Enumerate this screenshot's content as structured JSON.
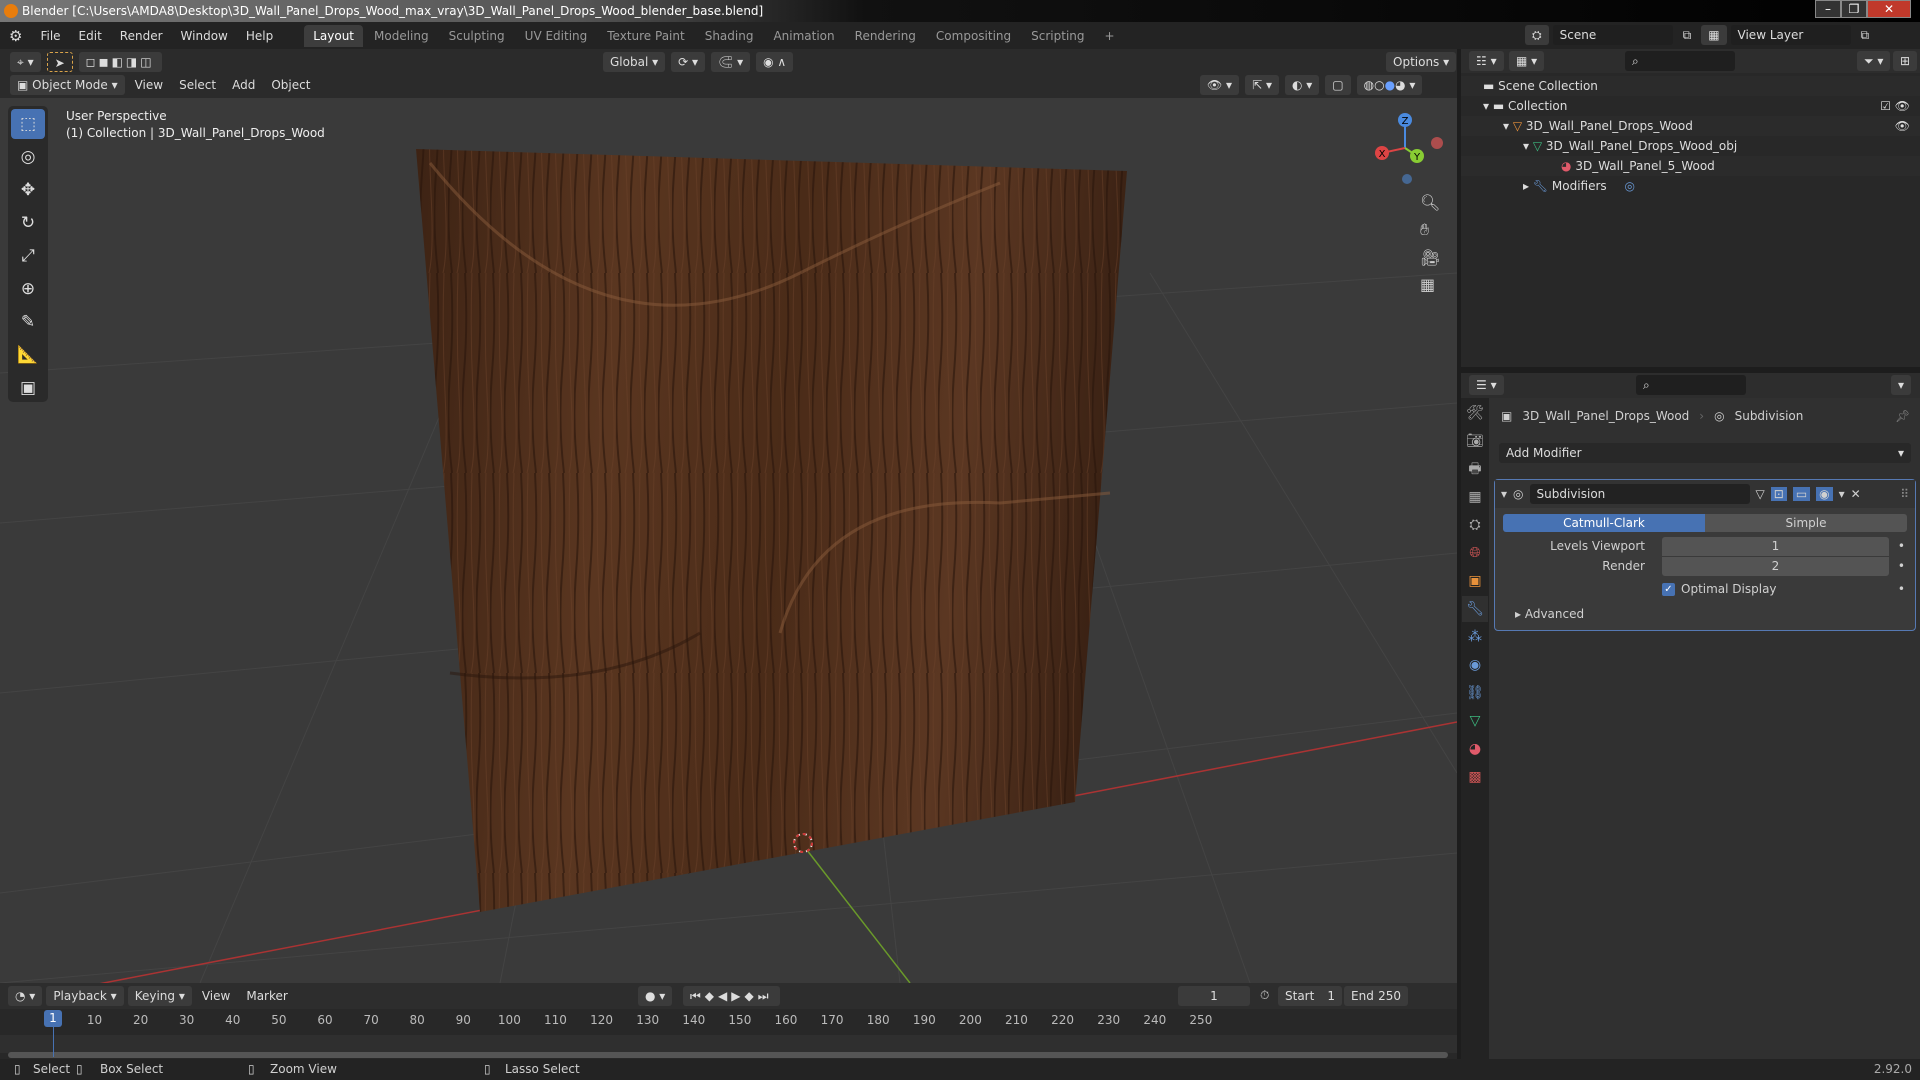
{
  "window": {
    "title": "Blender [C:\\Users\\AMDA8\\Desktop\\3D_Wall_Panel_Drops_Wood_max_vray\\3D_Wall_Panel_Drops_Wood_blender_base.blend]"
  },
  "menu": [
    "File",
    "Edit",
    "Render",
    "Window",
    "Help"
  ],
  "workspaces": [
    "Layout",
    "Modeling",
    "Sculpting",
    "UV Editing",
    "Texture Paint",
    "Shading",
    "Animation",
    "Rendering",
    "Compositing",
    "Scripting"
  ],
  "add_workspace": "+",
  "toolheader": {
    "orientation": "Global",
    "options": "Options"
  },
  "viewport": {
    "mode": "Object Mode",
    "menus": [
      "View",
      "Select",
      "Add",
      "Object"
    ],
    "overlay_title": "User Perspective",
    "overlay_sub": "(1) Collection | 3D_Wall_Panel_Drops_Wood",
    "axes": {
      "x": "X",
      "y": "Y",
      "z": "Z"
    }
  },
  "topright": {
    "scene": "Scene",
    "view_layer": "View Layer"
  },
  "outliner": {
    "items": [
      {
        "label": "Scene Collection"
      },
      {
        "label": "Collection"
      },
      {
        "label": "3D_Wall_Panel_Drops_Wood"
      },
      {
        "label": "3D_Wall_Panel_Drops_Wood_obj"
      },
      {
        "label": "3D_Wall_Panel_5_Wood"
      },
      {
        "label": "Modifiers"
      }
    ]
  },
  "properties": {
    "object": "3D_Wall_Panel_Drops_Wood",
    "modifier_crumb": "Subdivision",
    "add_modifier": "Add Modifier",
    "modifier": {
      "name": "Subdivision",
      "types": [
        "Catmull-Clark",
        "Simple"
      ],
      "active_type": "Catmull-Clark",
      "levels_viewport_label": "Levels Viewport",
      "levels_viewport": "1",
      "render_label": "Render",
      "render": "2",
      "optimal_display_label": "Optimal Display",
      "optimal_display": true,
      "advanced": "Advanced"
    }
  },
  "timeline": {
    "menus": [
      "Playback",
      "Keying",
      "View",
      "Marker"
    ],
    "current_frame": "1",
    "start_label": "Start",
    "start": "1",
    "end_label": "End",
    "end": "250",
    "ticks": [
      "10",
      "20",
      "30",
      "40",
      "50",
      "60",
      "70",
      "80",
      "90",
      "100",
      "110",
      "120",
      "130",
      "140",
      "150",
      "160",
      "170",
      "180",
      "190",
      "200",
      "210",
      "220",
      "230",
      "240",
      "250"
    ]
  },
  "status": {
    "select": "Select",
    "box_select": "Box Select",
    "zoom_view": "Zoom View",
    "lasso_select": "Lasso Select",
    "version": "2.92.0"
  }
}
